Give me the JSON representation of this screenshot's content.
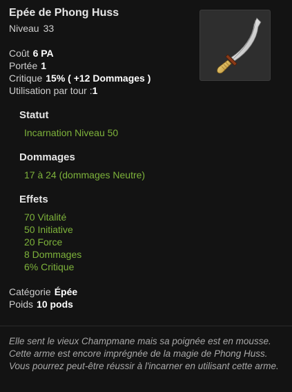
{
  "item": {
    "name": "Epée de Phong Huss",
    "level_label": "Niveau",
    "level_value": "33",
    "icon": "curved-sword-icon"
  },
  "stats": {
    "cost_label": "Coût",
    "cost_value": "6 PA",
    "range_label": "Portée",
    "range_value": "1",
    "critical_label": "Critique",
    "critical_value": "15% ( +12 Dommages )",
    "use_label": "Utilisation par tour :",
    "use_value": "1"
  },
  "status": {
    "title": "Statut",
    "value": "Incarnation Niveau 50"
  },
  "damage": {
    "title": "Dommages",
    "value": "17 à 24 (dommages Neutre)"
  },
  "effects": {
    "title": "Effets",
    "items": [
      "70 Vitalité",
      "50 Initiative",
      "20 Force",
      "8 Dommages",
      "6% Critique"
    ]
  },
  "info": {
    "category_label": "Catégorie",
    "category_value": "Épée",
    "weight_label": "Poids",
    "weight_value": "10 pods"
  },
  "description": "Elle sent le vieux Champmane mais sa poignée est en mousse. Cette arme est encore imprégnée de la magie de Phong Huss. Vous pourrez peut-être réussir à l'incarner en utilisant cette arme.",
  "colors": {
    "background": "#131313",
    "effect_green": "#7eb33b",
    "title_white": "#e6e6e6",
    "description_gray": "#a8a8a8"
  }
}
